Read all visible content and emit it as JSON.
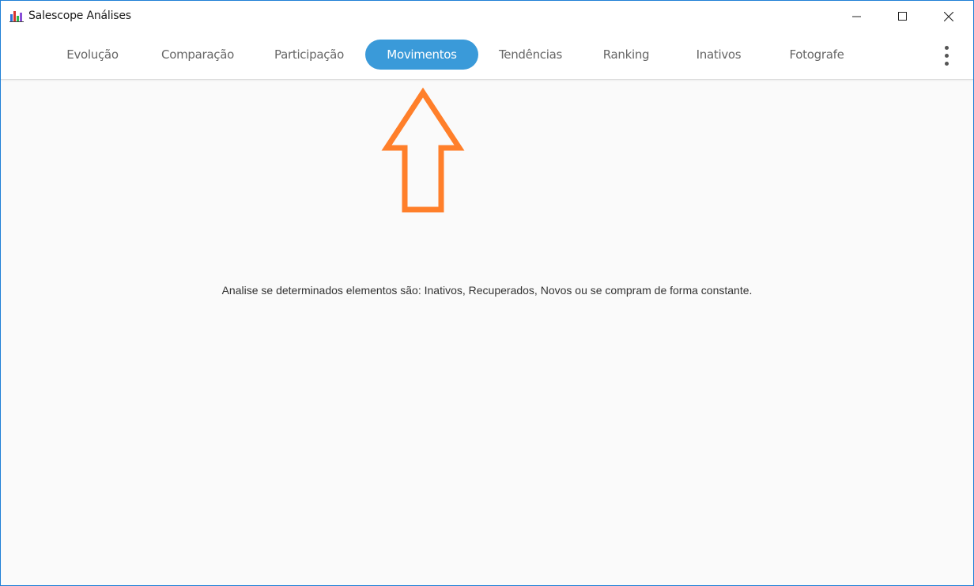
{
  "window": {
    "title": "Salescope Análises",
    "controls": {
      "minimize": "minimize-icon",
      "maximize": "maximize-icon",
      "close": "close-icon"
    }
  },
  "tabs": [
    {
      "label": "Evolução",
      "active": false
    },
    {
      "label": "Comparação",
      "active": false
    },
    {
      "label": "Participação",
      "active": false
    },
    {
      "label": "Movimentos",
      "active": true
    },
    {
      "label": "Tendências",
      "active": false
    },
    {
      "label": "Ranking",
      "active": false
    },
    {
      "label": "Inativos",
      "active": false
    },
    {
      "label": "Fotografe",
      "active": false
    }
  ],
  "menu_icon": "more-vertical-icon",
  "annotation": {
    "icon": "up-arrow-icon",
    "color": "#ff7f2a"
  },
  "content": {
    "message": "Analise se determinados elementos são: Inativos, Recuperados, Novos ou se compram de forma constante."
  },
  "colors": {
    "accent": "#3a9ad9",
    "window_border": "#1e7fd6",
    "annotation": "#ff7f2a"
  }
}
